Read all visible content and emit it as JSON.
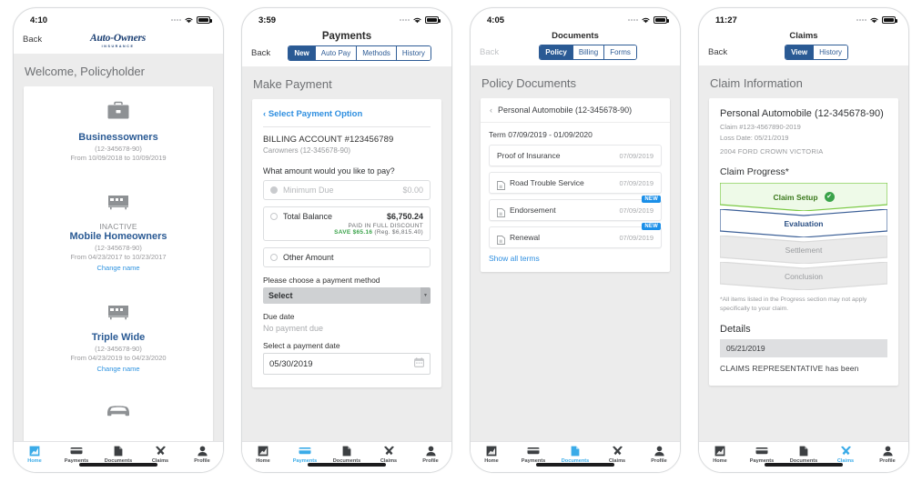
{
  "colors": {
    "brand_blue": "#2a5a94",
    "accent_cyan": "#3aabe8",
    "link_blue": "#2f8fe0",
    "green": "#3aa34a",
    "screen_bg": "#ececec",
    "badge_blue": "#1b8fe8"
  },
  "tabs": [
    {
      "label": "Home",
      "icon": "chart-icon"
    },
    {
      "label": "Payments",
      "icon": "credit-card-icon"
    },
    {
      "label": "Documents",
      "icon": "document-icon"
    },
    {
      "label": "Claims",
      "icon": "tools-icon"
    },
    {
      "label": "Profile",
      "icon": "person-icon"
    }
  ],
  "phones": [
    {
      "id": "home",
      "status_time": "4:10",
      "nav": {
        "back": "Back",
        "logo_main": "Auto-Owners",
        "logo_sub": "INSURANCE"
      },
      "page_title": "Welcome, Policyholder",
      "policies": [
        {
          "icon": "briefcase-icon",
          "status": "",
          "name": "Businessowners",
          "number": "(12-345678-90)",
          "term": "From 10/09/2018 to 10/09/2019",
          "change_name": ""
        },
        {
          "icon": "mobile-home-icon",
          "status": "INACTIVE",
          "name": "Mobile Homeowners",
          "number": "(12-345678-90)",
          "term": "From 04/23/2017 to 10/23/2017",
          "change_name": "Change name"
        },
        {
          "icon": "mobile-home-icon",
          "status": "",
          "name": "Triple Wide",
          "number": "(12-345678-90)",
          "term": "From 04/23/2019 to 04/23/2020",
          "change_name": "Change name"
        },
        {
          "icon": "car-icon",
          "status": "",
          "name": "",
          "number": "",
          "term": "",
          "change_name": ""
        }
      ],
      "active_tab": 0
    },
    {
      "id": "payments",
      "status_time": "3:59",
      "nav": {
        "back": "Back",
        "title": "Payments"
      },
      "segments": [
        {
          "label": "New",
          "active": true
        },
        {
          "label": "Auto Pay",
          "active": false
        },
        {
          "label": "Methods",
          "active": false
        },
        {
          "label": "History",
          "active": false
        }
      ],
      "page_title": "Make Payment",
      "form": {
        "select_payment_option": "Select Payment Option",
        "billing_account": "BILLING ACCOUNT #123456789",
        "billing_sub": "Carowners (12-345678-90)",
        "amount_question": "What amount would you like to pay?",
        "options": [
          {
            "label": "Minimum Due",
            "amount": "$0.00",
            "state": "disabled"
          },
          {
            "label": "Total Balance",
            "amount": "$6,750.24",
            "state": "enabled",
            "discount_line1": "PAID IN FULL DISCOUNT",
            "discount_save": "SAVE $65.16",
            "discount_reg": "(Reg. $6,815.40)"
          },
          {
            "label": "Other Amount",
            "amount": "",
            "state": "enabled"
          }
        ],
        "method_label": "Please choose a payment method",
        "method_value": "Select",
        "due_date_label": "Due date",
        "due_date_value": "No payment due",
        "payment_date_label": "Select a payment date",
        "payment_date_value": "05/30/2019"
      },
      "active_tab": 1
    },
    {
      "id": "documents",
      "status_time": "4:05",
      "nav": {
        "back": "Back",
        "title": "Documents"
      },
      "segments": [
        {
          "label": "Policy",
          "active": true
        },
        {
          "label": "Billing",
          "active": false
        },
        {
          "label": "Forms",
          "active": false
        }
      ],
      "page_title": "Policy Documents",
      "documents": {
        "policy_header": "Personal Automobile (12-345678-90)",
        "term": "Term 07/09/2019 - 01/09/2020",
        "rows": [
          {
            "name": "Proof of Insurance",
            "date": "07/09/2019",
            "icon": "",
            "badge": ""
          },
          {
            "name": "Road Trouble Service",
            "date": "07/09/2019",
            "icon": "document-icon",
            "badge": ""
          },
          {
            "name": "Endorsement",
            "date": "07/09/2019",
            "icon": "document-icon",
            "badge": "NEW"
          },
          {
            "name": "Renewal",
            "date": "07/09/2019",
            "icon": "document-icon",
            "badge": "NEW"
          }
        ],
        "show_all": "Show all terms"
      },
      "active_tab": 2
    },
    {
      "id": "claims",
      "status_time": "11:27",
      "nav": {
        "back": "Back",
        "title": "Claims"
      },
      "segments": [
        {
          "label": "View",
          "active": true
        },
        {
          "label": "History",
          "active": false
        }
      ],
      "page_title": "Claim Information",
      "claim": {
        "title": "Personal Automobile (12-345678-90)",
        "claim_number": "Claim #123-4567890-2019",
        "loss_date": "Loss Date: 05/21/2019",
        "vehicle": "2004 FORD CROWN VICTORIA",
        "progress_heading": "Claim Progress*",
        "steps": [
          {
            "label": "Claim Setup",
            "state": "complete"
          },
          {
            "label": "Evaluation",
            "state": "current"
          },
          {
            "label": "Settlement",
            "state": "pending"
          },
          {
            "label": "Conclusion",
            "state": "pending"
          }
        ],
        "footnote": "*All items listed in the Progress section may not apply specifically to your claim.",
        "details_heading": "Details",
        "details_date": "05/21/2019",
        "details_text": "CLAIMS REPRESENTATIVE has been"
      },
      "active_tab": 3
    }
  ]
}
